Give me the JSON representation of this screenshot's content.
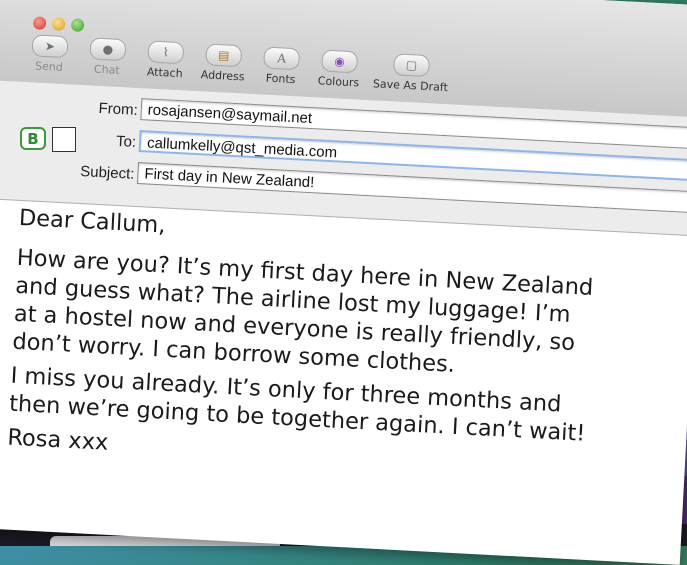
{
  "toolbar": {
    "buttons": [
      {
        "label": "Send",
        "icon": "paper-plane-icon",
        "glyph": "➤",
        "dim": true
      },
      {
        "label": "Chat",
        "icon": "chat-bubble-icon",
        "glyph": "●",
        "dim": true
      },
      {
        "label": "Attach",
        "icon": "paperclip-icon",
        "glyph": "⌇",
        "dim": false
      },
      {
        "label": "Address",
        "icon": "address-book-icon",
        "glyph": "▤",
        "dim": false
      },
      {
        "label": "Fonts",
        "icon": "font-icon",
        "glyph": "A",
        "dim": false
      },
      {
        "label": "Colours",
        "icon": "color-wheel-icon",
        "glyph": "◉",
        "dim": false
      },
      {
        "label": "Save As Draft",
        "icon": "draft-icon",
        "glyph": "▢",
        "dim": false
      }
    ]
  },
  "headers": {
    "from_label": "From:",
    "from_value": "rosajansen@saymail.net",
    "to_label": "To:",
    "to_value": "callumkelly@qst_media.com",
    "subject_label": "Subject:",
    "subject_value": "First day in New Zealand!"
  },
  "exercise": {
    "badge": "B"
  },
  "message": {
    "greeting": "Dear Callum,",
    "paragraph1": "How are you? It’s my first day here in New Zealand\nand guess what? The airline lost my luggage! I’m\nat a hostel now and everyone is really friendly, so\ndon’t worry. I can borrow some clothes.",
    "paragraph2": "I miss you already. It’s only for three months and\nthen we’re going to be together again. I can’t wait!",
    "signoff": "Rosa xxx"
  },
  "colors": {
    "badge_green": "#3a9a3a",
    "focus_ring": "#8cb6e8",
    "background_purple": "#6b3f95"
  }
}
